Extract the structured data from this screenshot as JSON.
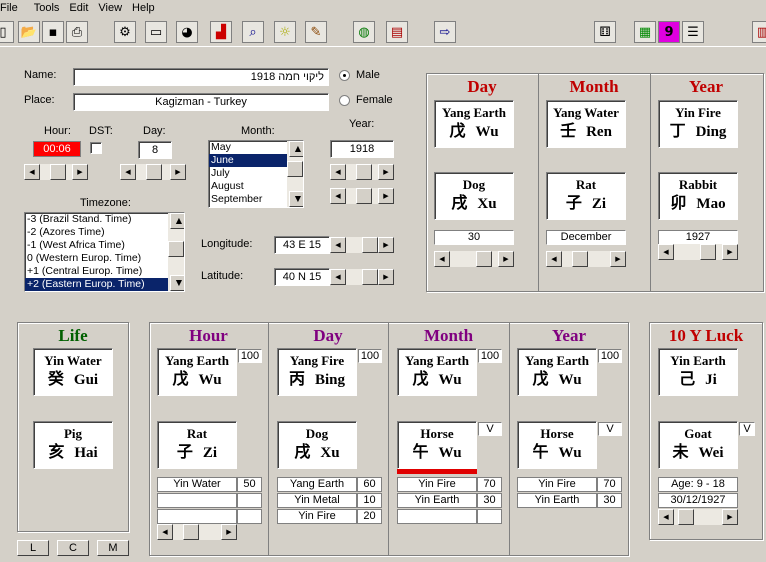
{
  "menu": [
    "File",
    "Tools",
    "Edit",
    "View",
    "Help"
  ],
  "toolbar_icons": [
    "new-icon",
    "open-icon",
    "save-icon",
    "print-icon",
    "settings-icon",
    "window-icon",
    "color-wheel-icon",
    "chart-icon",
    "magnifier-icon",
    "lightbulb-icon",
    "brush-icon",
    "globe-icon",
    "book-icon",
    "export-icon",
    "dice-icon",
    "grid-icon",
    "nine-icon",
    "list-icon",
    "book-red-icon"
  ],
  "toolbar_nine": "9",
  "form": {
    "name_label": "Name:",
    "name_value": "ליקוי חמה 1918",
    "place_label": "Place:",
    "place_value": "Kagizman - Turkey",
    "male_label": "Male",
    "female_label": "Female",
    "gender_selected": "Male",
    "hour_label": "Hour:",
    "hour_value": "00:06",
    "dst_label": "DST:",
    "day_label": "Day:",
    "day_value": "8",
    "month_label": "Month:",
    "months": [
      "May",
      "June",
      "July",
      "August",
      "September"
    ],
    "month_selected": "June",
    "year_label": "Year:",
    "year_value": "1918",
    "timezone_label": "Timezone:",
    "timezones": [
      "-3 (Brazil Stand.  Time)",
      "-2 (Azores Time)",
      "-1 (West Africa Time)",
      "0 (Western Europ. Time)",
      "+1 (Central Europ. Time)",
      "+2 (Eastern Europ. Time)"
    ],
    "timezone_selected": "+2 (Eastern Europ. Time)",
    "longitude_label": "Longitude:",
    "longitude_value": "43 E 15",
    "latitude_label": "Latitude:",
    "latitude_value": "40 N 15"
  },
  "top_pillars": [
    {
      "title": "Day",
      "stem_en": "Yang Earth",
      "stem_cn": "戊",
      "stem_py": "Wu",
      "branch_en": "Dog",
      "branch_cn": "戌",
      "branch_py": "Xu",
      "field": "30"
    },
    {
      "title": "Month",
      "stem_en": "Yang Water",
      "stem_cn": "壬",
      "stem_py": "Ren",
      "branch_en": "Rat",
      "branch_cn": "子",
      "branch_py": "Zi",
      "field": "December"
    },
    {
      "title": "Year",
      "stem_en": "Yin Fire",
      "stem_cn": "丁",
      "stem_py": "Ding",
      "branch_en": "Rabbit",
      "branch_cn": "卯",
      "branch_py": "Mao",
      "field": "1927"
    }
  ],
  "life": {
    "title": "Life",
    "stem_en": "Yin Water",
    "stem_cn": "癸",
    "stem_py": "Gui",
    "branch_en": "Pig",
    "branch_cn": "亥",
    "branch_py": "Hai"
  },
  "pillars": [
    {
      "title": "Hour",
      "score": "100",
      "stem_en": "Yang Earth",
      "stem_cn": "戊",
      "stem_py": "Wu",
      "branch_en": "Rat",
      "branch_cn": "子",
      "branch_py": "Zi",
      "mark": "",
      "hidden": [
        {
          "name": "Yin Water",
          "val": "50"
        },
        {
          "name": "",
          "val": ""
        },
        {
          "name": "",
          "val": ""
        }
      ]
    },
    {
      "title": "Day",
      "score": "100",
      "stem_en": "Yang Fire",
      "stem_cn": "丙",
      "stem_py": "Bing",
      "branch_en": "Dog",
      "branch_cn": "戌",
      "branch_py": "Xu",
      "mark": "",
      "hidden": [
        {
          "name": "Yang Earth",
          "val": "60"
        },
        {
          "name": "Yin Metal",
          "val": "10"
        },
        {
          "name": "Yin Fire",
          "val": "20"
        }
      ]
    },
    {
      "title": "Month",
      "score": "100",
      "stem_en": "Yang Earth",
      "stem_cn": "戊",
      "stem_py": "Wu",
      "branch_en": "Horse",
      "branch_cn": "午",
      "branch_py": "Wu",
      "mark": "V",
      "hidden": [
        {
          "name": "Yin Fire",
          "val": "70"
        },
        {
          "name": "Yin Earth",
          "val": "30"
        },
        {
          "name": "",
          "val": ""
        }
      ]
    },
    {
      "title": "Year",
      "score": "100",
      "stem_en": "Yang Earth",
      "stem_cn": "戊",
      "stem_py": "Wu",
      "branch_en": "Horse",
      "branch_cn": "午",
      "branch_py": "Wu",
      "mark": "V",
      "hidden": [
        {
          "name": "Yin Fire",
          "val": "70"
        },
        {
          "name": "Yin Earth",
          "val": "30"
        },
        {
          "name": "",
          "val": ""
        }
      ]
    }
  ],
  "luck": {
    "title": "10 Y Luck",
    "stem_en": "Yin Earth",
    "stem_cn": "己",
    "stem_py": "Ji",
    "branch_en": "Goat",
    "branch_cn": "未",
    "branch_py": "Wei",
    "mark": "V",
    "age": "Age: 9 - 18",
    "date": "30/12/1927"
  },
  "bottom_buttons": [
    "L",
    "C",
    "M"
  ],
  "colors": {
    "day": "#c00000",
    "hour": "#800080",
    "life": "#006000",
    "hour_field_bg": "#ff0000"
  }
}
